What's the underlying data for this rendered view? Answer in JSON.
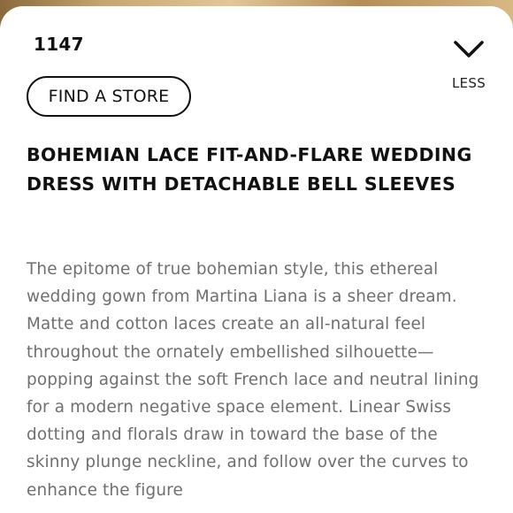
{
  "style_number": "1147",
  "collapse": {
    "label": "LESS",
    "icon": "chevron-down-icon"
  },
  "find_store_label": "FIND A STORE",
  "product": {
    "title": "BOHEMIAN LACE FIT-AND-FLARE WEDDING DRESS WITH DETACHABLE BELL SLEEVES",
    "description": "The epitome of true bohemian style, this ethereal wedding gown from Martina Liana is a sheer dream. Matte and cotton laces create an all-natural feel throughout the ornately embellished silhouette—popping against the soft French lace and neutral lining for a modern negative space element. Linear Swiss dotting and florals draw in toward the base of the skinny plunge neckline, and follow over the curves to enhance the figure"
  },
  "colors": {
    "text": "#111111",
    "description_text": "#6f6f6f",
    "sheet_background": "#ffffff"
  }
}
